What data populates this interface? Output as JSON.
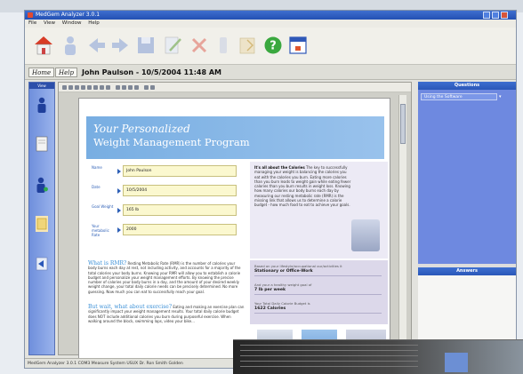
{
  "window": {
    "title": "MedGem Analyzer 3.0.1"
  },
  "menu": {
    "items": [
      "File",
      "View",
      "Window",
      "Help"
    ]
  },
  "toolbar": {
    "icons": [
      "home-icon",
      "user-icon",
      "back-icon",
      "forward-icon",
      "save-icon",
      "edit-icon",
      "delete-icon",
      "transfer-icon",
      "open-icon",
      "help-icon",
      "calendar-icon"
    ]
  },
  "nav": {
    "home_label": "Home",
    "help_label": "Help",
    "patient_header": "John Paulson - 10/5/2004 11:48 AM"
  },
  "leftpanel": {
    "header": "View"
  },
  "document": {
    "title_line1": "Your Personalized",
    "title_line2": "Weight Management Program",
    "fields": [
      {
        "label": "Name",
        "value": "John Paulson"
      },
      {
        "label": "Date",
        "value": "10/5/2004"
      },
      {
        "label": "Goal Weight",
        "value": "165 lb"
      },
      {
        "label": "Your metabolic Rate",
        "value": "2000"
      }
    ],
    "calories_title": "It's all about the Calories",
    "calories_text": "The key to successfully managing your weight is balancing the calories you eat with the calories you burn. Eating more calories than you burn leads to weight gain while eating fewer calories than you burn results in weight loss. Knowing how many calories our body burns each day by measuring our resting metabolic rate (RMR) is the missing link that allows us to determine a calorie budget - how much food to eat to achieve your goals.",
    "summary": [
      {
        "label": "Based on your lifestyle/occupational our/activities it",
        "value": "Stationary or Office-Work"
      },
      {
        "label": "And your a healthy weight goal of",
        "value": "7 lb per week"
      },
      {
        "label": "Your Total Daily Calorie Budget is",
        "value": "1622 Calories"
      }
    ],
    "rmr_title": "What is RMR?",
    "rmr_text": "Resting Metabolic Rate (RMR) is the number of calories your body burns each day at rest, not including activity, and accounts for a majority of the total calories your body burns. Knowing your RMR will allow you to establish a calorie budget and personalize your weight management efforts. By knowing the precise number of calories your body burns in a day, and the amount of your desired weekly weight change, your total daily calorie needs can be precisely determined. No more guessing. Now much you can eat to successfully reach your goal.",
    "wait_title": "But wait, what about exercise?",
    "wait_text": "Eating and making an exercise plan can significantly impact your weight management results. Your total daily calorie budget does NOT include additional calories you burn during purposeful exercise. When walking around the block, swimming laps, video your bike..."
  },
  "rightpanel": {
    "questions_header": "Questions",
    "topic_select": "Using the Software",
    "answers_header": "Answers"
  },
  "statusbar": {
    "text": "MedGem Analyzer 3.0.1    COM3    Measure System USUX    Dr. Ron Smith    Golden"
  },
  "colors": {
    "titlebar": "#2a57b8",
    "panel_blue": "#6e89e0",
    "doc_header": "#78aee2",
    "field_bg": "#fbf8cf"
  }
}
